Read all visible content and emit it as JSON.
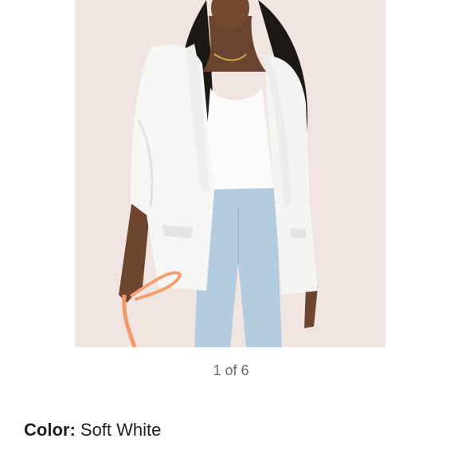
{
  "product": {
    "image_alt": "Woman wearing a soft white open blazer over a white tank with light wash jeans",
    "pager_text": "1 of 6",
    "color_label": "Color:",
    "color_value": "Soft White"
  }
}
